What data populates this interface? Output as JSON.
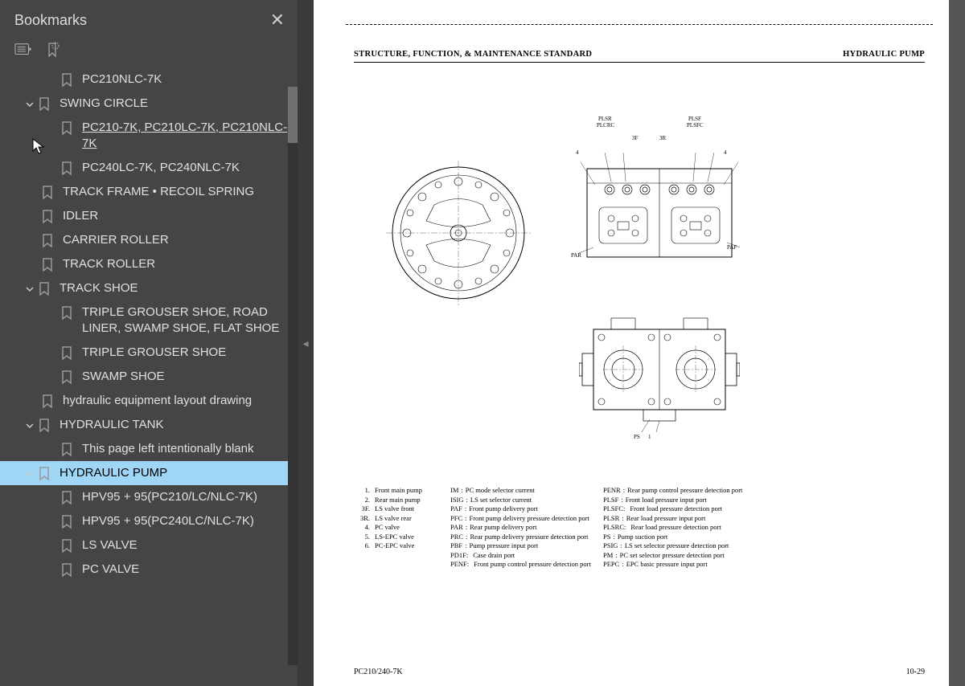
{
  "sidebar": {
    "title": "Bookmarks",
    "tree": [
      {
        "label": "PC210NLC-7K",
        "level": "lvl1c",
        "caret": false
      },
      {
        "label": "SWING CIRCLE",
        "level": "lvl1 withcaret",
        "caret": true
      },
      {
        "label": "PC210-7K, PC210LC-7K, PC210NLC-7K",
        "level": "lvl1c",
        "caret": false,
        "underlined": true
      },
      {
        "label": "PC240LC-7K, PC240NLC-7K",
        "level": "lvl1c",
        "caret": false
      },
      {
        "label": "TRACK FRAME • RECOIL SPRING",
        "level": "lvl1",
        "caret": false
      },
      {
        "label": "IDLER",
        "level": "lvl1",
        "caret": false
      },
      {
        "label": "CARRIER ROLLER",
        "level": "lvl1",
        "caret": false
      },
      {
        "label": "TRACK ROLLER",
        "level": "lvl1",
        "caret": false
      },
      {
        "label": "TRACK SHOE",
        "level": "lvl1 withcaret",
        "caret": true
      },
      {
        "label": "TRIPLE GROUSER SHOE, ROAD LINER, SWAMP SHOE, FLAT SHOE",
        "level": "lvl1c",
        "caret": false
      },
      {
        "label": "TRIPLE GROUSER SHOE",
        "level": "lvl1c",
        "caret": false
      },
      {
        "label": "SWAMP SHOE",
        "level": "lvl1c",
        "caret": false
      },
      {
        "label": "hydraulic equipment layout drawing",
        "level": "lvl1",
        "caret": false
      },
      {
        "label": "HYDRAULIC TANK",
        "level": "lvl1 withcaret",
        "caret": true
      },
      {
        "label": "This page left intentionally blank",
        "level": "lvl1c",
        "caret": false
      },
      {
        "label": "HYDRAULIC PUMP",
        "level": "lvl1 withcaret",
        "caret": true,
        "selected": true
      },
      {
        "label": "HPV95 + 95(PC210/LC/NLC-7K)",
        "level": "lvl1c",
        "caret": false
      },
      {
        "label": "HPV95 + 95(PC240LC/NLC-7K)",
        "level": "lvl1c",
        "caret": false
      },
      {
        "label": "LS VALVE",
        "level": "lvl1c",
        "caret": false
      },
      {
        "label": "PC VALVE",
        "level": "lvl1c",
        "caret": false
      }
    ]
  },
  "page": {
    "header_left": "STRUCTURE, FUNCTION, & MAINTENANCE STANDARD",
    "header_right": "HYDRAULIC PUMP",
    "labels": {
      "plsr": "PLSR",
      "plcrc": "PLCRC",
      "plsf": "PLSF",
      "plsfc": "PLSFC",
      "f3": "3F",
      "r3": "3R",
      "par": "PAR",
      "paf": "PAF",
      "n4a": "4",
      "n4b": "4",
      "ps": "PS",
      "n1": "1"
    },
    "legend": {
      "col1": [
        {
          "k": "1.",
          "v": "Front main pump"
        },
        {
          "k": "2.",
          "v": "Rear main pump"
        },
        {
          "k": "3F.",
          "v": "LS valve front"
        },
        {
          "k": "3R.",
          "v": "LS valve rear"
        },
        {
          "k": "4.",
          "v": "PC valve"
        },
        {
          "k": "5.",
          "v": "LS-EPC valve"
        },
        {
          "k": "6.",
          "v": "PC-EPC valve"
        }
      ],
      "col2": [
        {
          "k": "IM",
          "v": "PC mode selector current"
        },
        {
          "k": "ISIG",
          "v": "LS set selector current"
        },
        {
          "k": "PAF",
          "v": "Front pump delivery port"
        },
        {
          "k": "PFC",
          "v": "Front pump delivery pressure detection port"
        },
        {
          "k": "PAR",
          "v": "Rear pump delivery port"
        },
        {
          "k": "PRC",
          "v": "Rear pump delivery pressure detection port"
        },
        {
          "k": "PBF",
          "v": "Pump pressure input port"
        },
        {
          "k": "PD1F:",
          "v": "Case drain port"
        },
        {
          "k": "PENF:",
          "v": "Front pump control pressure detection port"
        }
      ],
      "col3": [
        {
          "k": "PENR",
          "v": "Rear pump control pressure detection port"
        },
        {
          "k": "PLSF",
          "v": "Front load pressure input port"
        },
        {
          "k": "PLSFC:",
          "v": "Front load pressure detection port"
        },
        {
          "k": "PLSR",
          "v": "Rear load pressure input port"
        },
        {
          "k": "PLSRC:",
          "v": "Rear load pressure detection port"
        },
        {
          "k": "PS",
          "v": "Pump suction port"
        },
        {
          "k": "PSIG",
          "v": "LS set selector pressure detection port"
        },
        {
          "k": "PM",
          "v": "PC set selector pressure detection port"
        },
        {
          "k": "PEPC",
          "v": "EPC basic pressure input port"
        }
      ]
    },
    "footer_left": "PC210/240-7K",
    "footer_right": "10-29"
  }
}
